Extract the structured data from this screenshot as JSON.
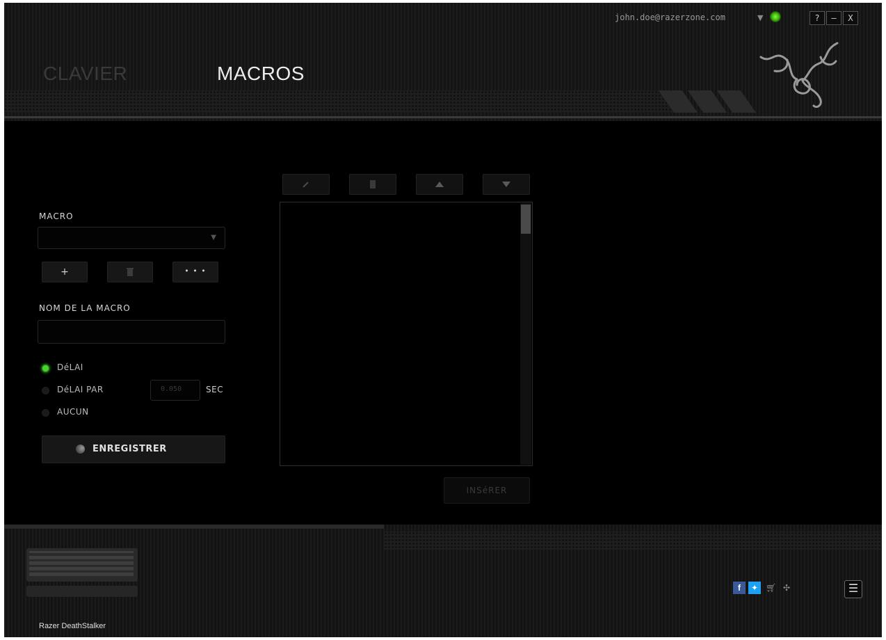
{
  "account": {
    "email": "john.doe@razerzone.com",
    "dropdown_icon": "caret-down-icon",
    "status_color": "#44d62c"
  },
  "window_controls": {
    "help": "?",
    "minimize": "–",
    "close": "X"
  },
  "tabs": [
    {
      "label": "CLAVIER",
      "active": false
    },
    {
      "label": "MACROS",
      "active": true
    }
  ],
  "macro_panel": {
    "macro_label": "MACRO",
    "macro_select_value": "",
    "actions": {
      "add": "+",
      "delete_icon": "trash-icon",
      "more": "• • •"
    },
    "name_label": "NOM DE LA MACRO",
    "name_value": "",
    "delay_options": [
      {
        "label": "DéLAI",
        "selected": true
      },
      {
        "label": "DéLAI PAR",
        "selected": false
      },
      {
        "label": "AUCUN",
        "selected": false
      }
    ],
    "delay_value": "0.050",
    "delay_unit": "SEC",
    "record_label": "ENREGISTRER"
  },
  "editor": {
    "toolbar": [
      "edit-icon",
      "trash-icon",
      "move-up-icon",
      "move-down-icon"
    ],
    "insert_label": "INSéRER"
  },
  "footer": {
    "device_name": "Razer DeathStalker",
    "icons": [
      "facebook-icon",
      "twitter-icon",
      "cart-icon",
      "razer-icon"
    ],
    "menu_icon": "menu-icon"
  },
  "colors": {
    "accent": "#44d62c",
    "background": "#000000"
  }
}
